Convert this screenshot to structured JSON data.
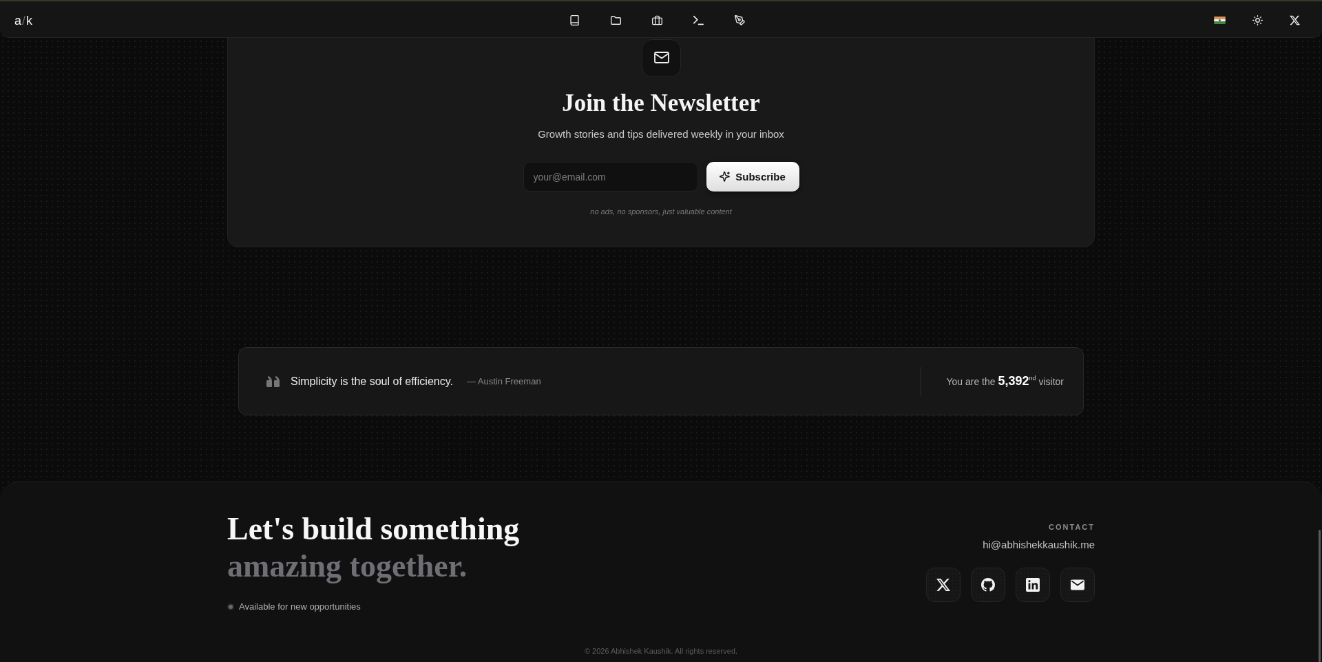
{
  "nav": {
    "logo": [
      {
        "text": "a",
        "muted": false
      },
      {
        "text": "/",
        "muted": true
      },
      {
        "text": "k",
        "muted": false
      }
    ]
  },
  "newsletter": {
    "title": "Join the Newsletter",
    "subtitle": "Growth stories and tips delivered weekly in your inbox",
    "email_field": {
      "placeholder": "your@email.com"
    },
    "subscribe_button": "Subscribe",
    "note": "no ads, no sponsors, just valuable content"
  },
  "quote_bar": {
    "quote": "Simplicity is the soul of efficiency.",
    "author": "— Austin Freeman",
    "visitor_text": "You are the **5,392**$^{nd}$ visitor"
  },
  "footer": {
    "heading": [
      {
        "text": "Let's build something",
        "muted": false
      },
      {
        "text": "amazing together.",
        "muted": true
      }
    ],
    "status": "Available for new opportunities",
    "contact_label": "CONTACT",
    "email": "hi@abhishekkaushik.me",
    "copyright": "© 2026 Abhishek Kaushik. All rights reserved."
  }
}
